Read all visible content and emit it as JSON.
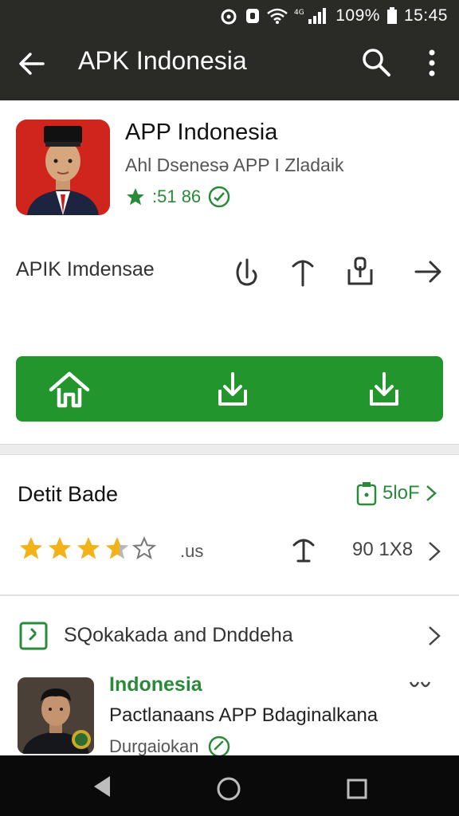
{
  "status_bar": {
    "battery": "109%",
    "time": "15:45",
    "icons": [
      "alarm-icon",
      "nfc-icon",
      "wifi-icon",
      "signal-icon",
      "battery-icon"
    ]
  },
  "app_bar": {
    "title": "APK Indonesia",
    "icons": [
      "back-arrow-icon",
      "search-icon",
      "more-vert-icon"
    ]
  },
  "app": {
    "name": "APP Indonesia",
    "developer": "Ahl Dsenesə APP I Zladaik",
    "rating": ":51 86",
    "subtitle": "APIK Imdensae"
  },
  "detail": {
    "title": "Detit Bade",
    "right_label": "5loF",
    "stars_label": ".us",
    "stars_value": 3.5,
    "stars_max": 5,
    "size_label": "90 1X8"
  },
  "section": {
    "title": "SQokakada and Dnddeha"
  },
  "card": {
    "title": "Indonesia",
    "subtitle": "Pactlanaans APP Bdaginalkana",
    "meta": "Durgaiokan"
  },
  "colors": {
    "app_bar": "#2a2a26",
    "accent_green": "#22962c",
    "text_green": "#2a8a3a",
    "star_gold": "#f2b21a",
    "nav_bar": "#0a0a0a"
  }
}
